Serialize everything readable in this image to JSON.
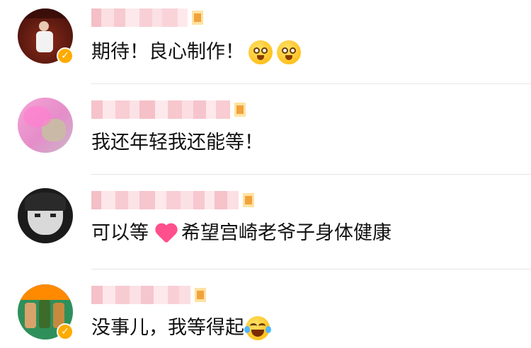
{
  "comments": [
    {
      "text": "期待！良心制作！",
      "verified": true,
      "verified_icon": "check-icon",
      "emojis": [
        "amazed-face-emoji",
        "amazed-face-emoji"
      ],
      "colors": {
        "badge": "#ffab00"
      }
    },
    {
      "text": "我还年轻我还能等！",
      "verified": false
    },
    {
      "text_before": "可以等",
      "text_after": "希望宫崎老爷子身体健康",
      "verified": false,
      "emojis": [
        "heart-emoji"
      ]
    },
    {
      "text": "没事儿，我等得起",
      "verified": true,
      "verified_icon": "check-icon",
      "emojis": [
        "laughing-tears-emoji"
      ]
    }
  ],
  "badge_glyph": "✓"
}
